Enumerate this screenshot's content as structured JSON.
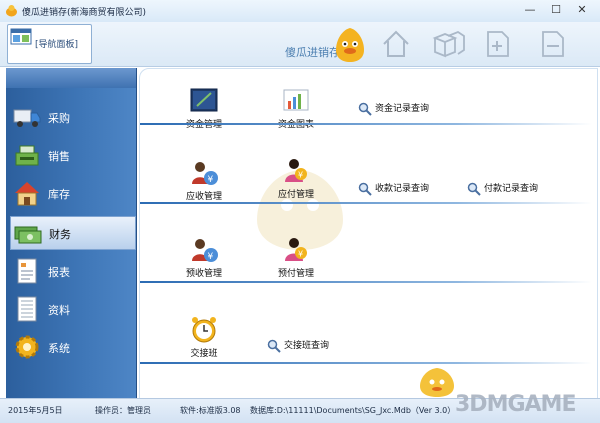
{
  "window": {
    "title": "傻瓜进销存(新海商贸有限公司)"
  },
  "toolbar": {
    "nav_tab_label": "[导航面板]",
    "brand": "傻瓜进销存"
  },
  "sidebar": {
    "items": [
      {
        "label": "采购",
        "icon": "truck-icon"
      },
      {
        "label": "销售",
        "icon": "cash-register-icon"
      },
      {
        "label": "库存",
        "icon": "house-icon"
      },
      {
        "label": "财务",
        "icon": "money-icon",
        "active": true
      },
      {
        "label": "报表",
        "icon": "report-icon"
      },
      {
        "label": "资料",
        "icon": "document-icon"
      },
      {
        "label": "系统",
        "icon": "gear-icon"
      }
    ]
  },
  "main": {
    "row1": {
      "fund_mgmt": "资金管理",
      "fund_chart": "资金图表",
      "fund_query": "资金记录查询"
    },
    "row2": {
      "receivable": "应收管理",
      "payable": "应付管理",
      "receipt_query": "收款记录查询",
      "payment_query": "付款记录查询"
    },
    "row3": {
      "prereceive": "预收管理",
      "prepay": "预付管理"
    },
    "row4": {
      "shift": "交接班",
      "shift_query": "交接班查询"
    }
  },
  "status": {
    "date": "2015年5月5日",
    "operator": "操作员：管理员",
    "software": "软件:标准版3.08",
    "database": "数据库:D:\\11111\\Documents\\SG_Jxc.Mdb（Ver 3.0）"
  },
  "watermark": "3DMGAME",
  "colors": {
    "accent": "#3f77b8",
    "sidebar": "#2c5f9d"
  }
}
